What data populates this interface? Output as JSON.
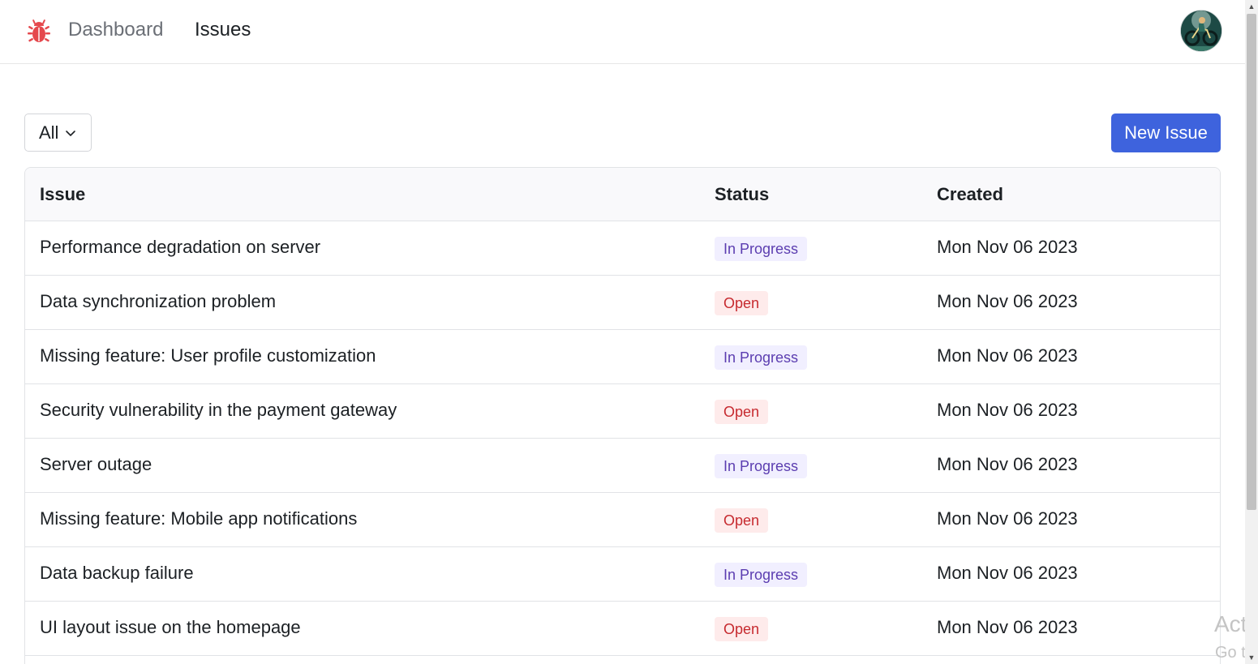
{
  "nav": {
    "logo_icon": "bug-icon",
    "dashboard_label": "Dashboard",
    "issues_label": "Issues",
    "avatar_icon": "avatar-cyclist"
  },
  "toolbar": {
    "filter_value": "All",
    "new_issue_label": "New Issue"
  },
  "table": {
    "headers": {
      "issue": "Issue",
      "status": "Status",
      "created": "Created"
    },
    "rows": [
      {
        "title": "Performance degradation on server",
        "status": "In Progress",
        "created": "Mon Nov 06 2023"
      },
      {
        "title": "Data synchronization problem",
        "status": "Open",
        "created": "Mon Nov 06 2023"
      },
      {
        "title": "Missing feature: User profile customization",
        "status": "In Progress",
        "created": "Mon Nov 06 2023"
      },
      {
        "title": "Security vulnerability in the payment gateway",
        "status": "Open",
        "created": "Mon Nov 06 2023"
      },
      {
        "title": "Server outage",
        "status": "In Progress",
        "created": "Mon Nov 06 2023"
      },
      {
        "title": "Missing feature: Mobile app notifications",
        "status": "Open",
        "created": "Mon Nov 06 2023"
      },
      {
        "title": "Data backup failure",
        "status": "In Progress",
        "created": "Mon Nov 06 2023"
      },
      {
        "title": "UI layout issue on the homepage",
        "status": "Open",
        "created": "Mon Nov 06 2023"
      }
    ]
  },
  "colors": {
    "primary": "#3e63dd",
    "logo": "#e5484d",
    "badge_in_progress_bg": "#f1efff",
    "badge_in_progress_fg": "#5b3db0",
    "badge_open_bg": "#feebeb",
    "badge_open_fg": "#c62a2f"
  },
  "watermark": {
    "line1": "Acti",
    "line2": "Go to"
  }
}
